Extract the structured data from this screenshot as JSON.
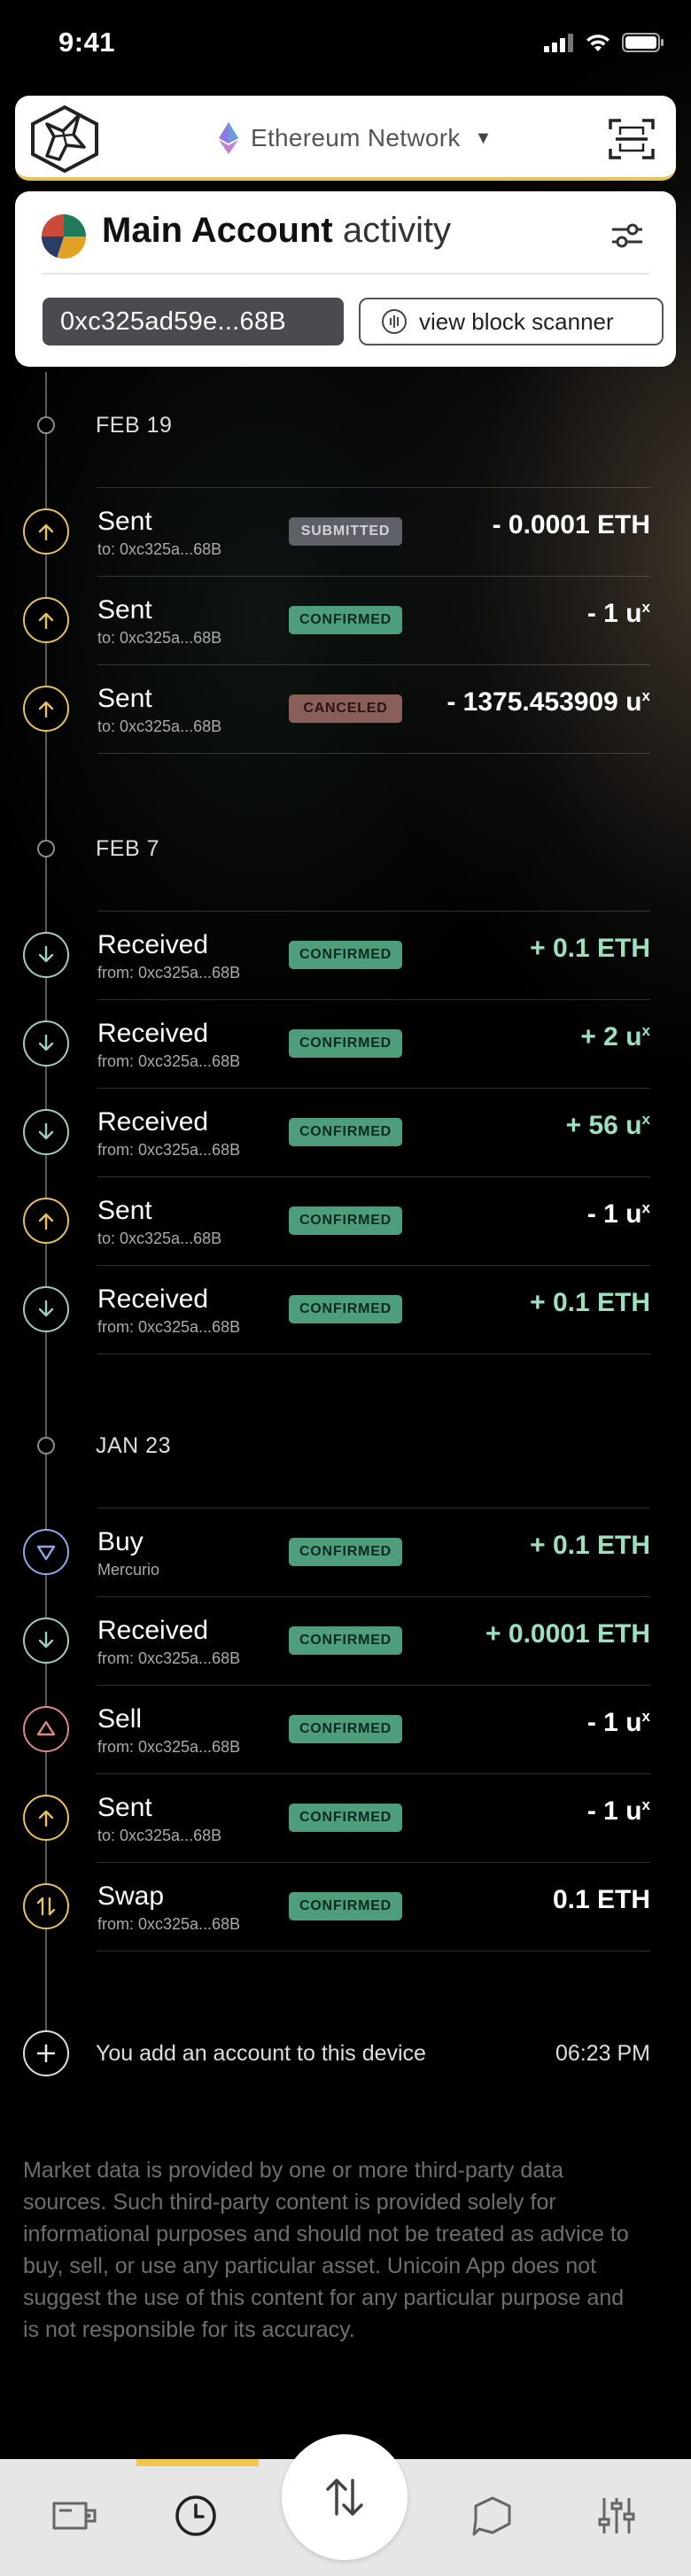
{
  "status_bar": {
    "time": "9:41"
  },
  "header": {
    "network_label": "Ethereum Network",
    "network_caret": "▼"
  },
  "account": {
    "name": "Main Account",
    "suffix": "activity",
    "address": "0xc325ad59e...68B",
    "scanner_label": "view block scanner"
  },
  "groups": [
    {
      "date": "FEB 19",
      "items": [
        {
          "kind": "sent",
          "title": "Sent",
          "sub": "to: 0xc325a...68B",
          "status": "SUBMITTED",
          "amount": "- 0.0001 ETH",
          "unit_sup": ""
        },
        {
          "kind": "sent",
          "title": "Sent",
          "sub": "to: 0xc325a...68B",
          "status": "CONFIRMED",
          "amount": "- 1 u",
          "unit_sup": "x"
        },
        {
          "kind": "sent",
          "title": "Sent",
          "sub": "to: 0xc325a...68B",
          "status": "CANCELED",
          "amount": "- 1375.453909 u",
          "unit_sup": "x"
        }
      ]
    },
    {
      "date": "FEB 7",
      "items": [
        {
          "kind": "received",
          "title": "Received",
          "sub": "from: 0xc325a...68B",
          "status": "CONFIRMED",
          "amount": "+ 0.1 ETH",
          "unit_sup": ""
        },
        {
          "kind": "received",
          "title": "Received",
          "sub": "from: 0xc325a...68B",
          "status": "CONFIRMED",
          "amount": "+ 2 u",
          "unit_sup": "x"
        },
        {
          "kind": "received",
          "title": "Received",
          "sub": "from: 0xc325a...68B",
          "status": "CONFIRMED",
          "amount": "+ 56 u",
          "unit_sup": "x"
        },
        {
          "kind": "sent",
          "title": "Sent",
          "sub": "to: 0xc325a...68B",
          "status": "CONFIRMED",
          "amount": "- 1 u",
          "unit_sup": "x"
        },
        {
          "kind": "received",
          "title": "Received",
          "sub": "from: 0xc325a...68B",
          "status": "CONFIRMED",
          "amount": "+ 0.1 ETH",
          "unit_sup": ""
        }
      ]
    },
    {
      "date": "JAN 23",
      "items": [
        {
          "kind": "buy",
          "title": "Buy",
          "sub": "Mercurio",
          "status": "CONFIRMED",
          "amount": "+ 0.1 ETH",
          "unit_sup": ""
        },
        {
          "kind": "received",
          "title": "Received",
          "sub": "from: 0xc325a...68B",
          "status": "CONFIRMED",
          "amount": "+ 0.0001 ETH",
          "unit_sup": ""
        },
        {
          "kind": "sell",
          "title": "Sell",
          "sub": "from: 0xc325a...68B",
          "status": "CONFIRMED",
          "amount": "- 1 u",
          "unit_sup": "x"
        },
        {
          "kind": "sent",
          "title": "Sent",
          "sub": "to: 0xc325a...68B",
          "status": "CONFIRMED",
          "amount": "- 1 u",
          "unit_sup": "x"
        },
        {
          "kind": "swap",
          "title": "Swap",
          "sub": "from: 0xc325a...68B",
          "status": "CONFIRMED",
          "amount": "0.1 ETH",
          "unit_sup": ""
        }
      ]
    }
  ],
  "add_account": {
    "text": "You add an account to this device",
    "time": "06:23 PM"
  },
  "disclaimer": "Market data is provided by one or more third-party data sources. Such third-party content is provided solely for informational purposes and should not be treated as advice to buy, sell, or use any particular asset. Unicoin App does not suggest the use of this content for any particular purpose and is not responsible for its accuracy.",
  "tabs": [
    {
      "name": "wallet-icon"
    },
    {
      "name": "clock-icon",
      "active": true
    },
    {
      "name": "swap-icon"
    },
    {
      "name": "chat-icon"
    },
    {
      "name": "settings-sliders-icon"
    }
  ],
  "colors": {
    "sent": "#e6c15c",
    "received": "#9ccfb6",
    "buy": "#8fa9e8",
    "sell": "#d98a86",
    "swap": "#e6c15c",
    "confirmed": "#4e9e7e",
    "positive": "#9ce0bf",
    "accent": "#f2c64b"
  }
}
